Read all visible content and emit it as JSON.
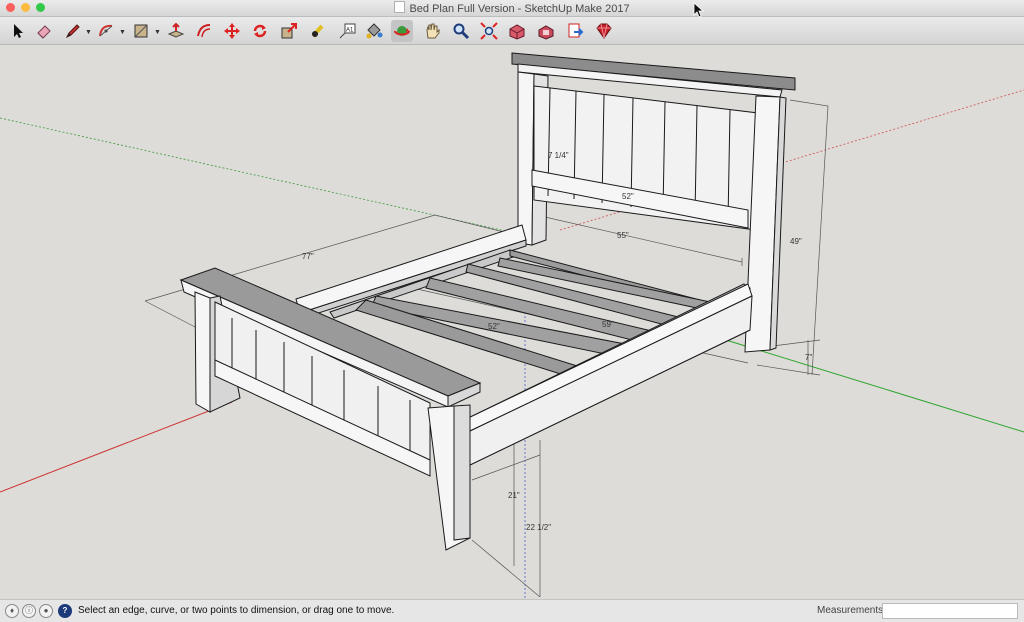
{
  "window": {
    "title": "Bed Plan Full Version - SketchUp Make 2017",
    "traffic_lights": [
      "#fc605c",
      "#fdbc40",
      "#34c84a"
    ]
  },
  "toolbar": {
    "tools": [
      {
        "name": "select-tool",
        "icon": "arrow-cursor-icon",
        "active": false
      },
      {
        "name": "eraser-tool",
        "icon": "eraser-icon",
        "active": false
      },
      {
        "name": "line-tool",
        "icon": "pencil-icon",
        "active": false,
        "dropdown": true
      },
      {
        "name": "arc-tool",
        "icon": "arc-icon",
        "active": false,
        "dropdown": true
      },
      {
        "name": "shapes-tool",
        "icon": "rectangle-icon",
        "active": false,
        "dropdown": true
      },
      {
        "name": "push-pull-tool",
        "icon": "push-pull-icon",
        "active": false
      },
      {
        "name": "offset-tool",
        "icon": "offset-icon",
        "active": false
      },
      {
        "name": "move-tool",
        "icon": "move-arrows-icon",
        "active": false
      },
      {
        "name": "rotate-tool",
        "icon": "rotate-icon",
        "active": false
      },
      {
        "name": "scale-tool",
        "icon": "scale-icon",
        "active": false
      },
      {
        "name": "tape-measure-tool",
        "icon": "tape-measure-icon",
        "active": false
      },
      {
        "name": "text-tool",
        "icon": "text-icon",
        "active": false
      },
      {
        "name": "paint-bucket-tool",
        "icon": "paint-bucket-icon",
        "active": false
      },
      {
        "name": "orbit-tool",
        "icon": "orbit-icon",
        "active": true
      },
      {
        "name": "pan-tool",
        "icon": "hand-icon",
        "active": false
      },
      {
        "name": "zoom-tool",
        "icon": "magnifier-icon",
        "active": false
      },
      {
        "name": "zoom-extents-tool",
        "icon": "zoom-extents-icon",
        "active": false
      },
      {
        "name": "3d-warehouse-button",
        "icon": "warehouse-icon",
        "active": false
      },
      {
        "name": "extension-warehouse-button",
        "icon": "extension-icon",
        "active": false
      },
      {
        "name": "send-to-layout-button",
        "icon": "layout-icon",
        "active": false
      },
      {
        "name": "extension-manager-button",
        "icon": "ruby-gem-icon",
        "active": false
      }
    ],
    "text_tool_glyph": "A1"
  },
  "model": {
    "dimensions": [
      "7 1/4\"",
      "52\"",
      "55\"",
      "77\"",
      "52\"",
      "59\"",
      "49\"",
      "7\"",
      "21\"",
      "22 1/2\""
    ],
    "axis_colors": {
      "red": "#d23a3a",
      "green": "#3fae3f",
      "blue": "#4a5fd0"
    }
  },
  "statusbar": {
    "icons": [
      "geo-location-icon",
      "credits-icon",
      "user-icon",
      "help-icon"
    ],
    "help_glyph": "?",
    "message": "Select an edge, curve, or two points to dimension, or drag one to move.",
    "measurements_label": "Measurements",
    "measurements_value": ""
  }
}
